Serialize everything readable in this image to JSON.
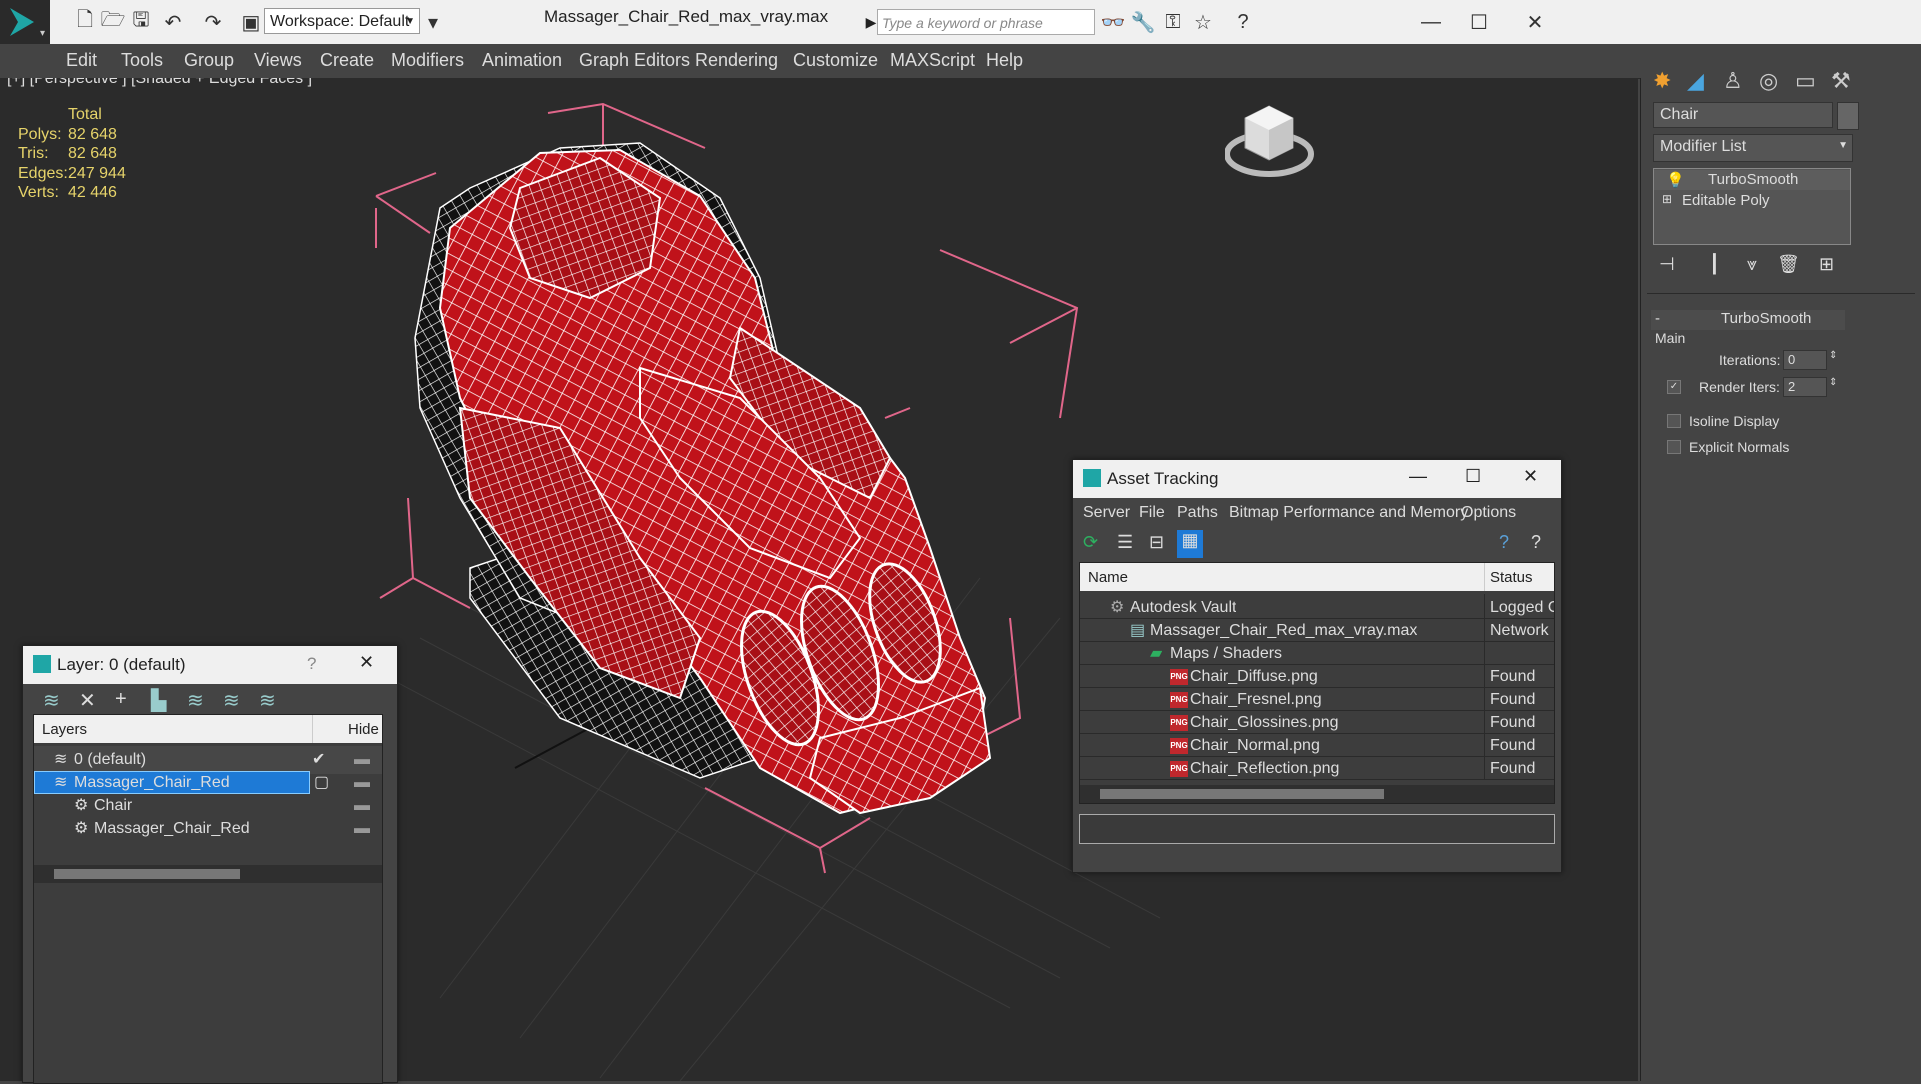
{
  "app": {
    "file_title": "Massager_Chair_Red_max_vray.max",
    "workspace": "Workspace: Default",
    "search_placeholder": "Type a keyword or phrase"
  },
  "menu": [
    "Edit",
    "Tools",
    "Group",
    "Views",
    "Create",
    "Modifiers",
    "Animation",
    "Graph Editors",
    "Rendering",
    "Customize",
    "MAXScript",
    "Help"
  ],
  "viewport": {
    "label": "[+] [Perspective ] [Shaded + Edged Faces ]",
    "stats_header": "Total",
    "stats": [
      {
        "label": "Polys:",
        "value": "82 648"
      },
      {
        "label": "Tris:",
        "value": "82 648"
      },
      {
        "label": "Edges:",
        "value": "247 944"
      },
      {
        "label": "Verts:",
        "value": "42 446"
      }
    ],
    "wire_color": "#ffffff",
    "mesh_color": "#c0121a"
  },
  "command_panel": {
    "object_name": "Chair",
    "modifier_list": "Modifier List",
    "stack": [
      "TurboSmooth",
      "Editable Poly"
    ],
    "rollout_title": "TurboSmooth",
    "group_main": "Main",
    "iterations_label": "Iterations:",
    "iterations_value": "0",
    "render_iters_label": "Render Iters:",
    "render_iters_value": "2",
    "render_iters_checked": true,
    "isoline_label": "Isoline Display",
    "explicit_normals_label": "Explicit Normals"
  },
  "layer_window": {
    "title": "Layer: 0 (default)",
    "help": "?",
    "col_layers": "Layers",
    "col_hide": "Hide",
    "rows": [
      {
        "name": "0 (default)",
        "indent": 1
      },
      {
        "name": "Massager_Chair_Red",
        "indent": 1,
        "selected": true
      },
      {
        "name": "Chair",
        "indent": 2
      },
      {
        "name": "Massager_Chair_Red",
        "indent": 2
      }
    ]
  },
  "asset_window": {
    "title": "Asset Tracking",
    "menu": [
      "Server",
      "File",
      "Paths",
      "Bitmap Performance and Memory",
      "Options"
    ],
    "col_name": "Name",
    "col_status": "Status",
    "rows": [
      {
        "name": "Autodesk Vault",
        "status": "Logged O",
        "indent": 1,
        "icon": "vault"
      },
      {
        "name": "Massager_Chair_Red_max_vray.max",
        "status": "Network F",
        "indent": 2,
        "icon": "max"
      },
      {
        "name": "Maps / Shaders",
        "status": "",
        "indent": 3,
        "icon": "maps"
      },
      {
        "name": "Chair_Diffuse.png",
        "status": "Found",
        "indent": 4,
        "icon": "png"
      },
      {
        "name": "Chair_Fresnel.png",
        "status": "Found",
        "indent": 4,
        "icon": "png"
      },
      {
        "name": "Chair_Glossines.png",
        "status": "Found",
        "indent": 4,
        "icon": "png"
      },
      {
        "name": "Chair_Normal.png",
        "status": "Found",
        "indent": 4,
        "icon": "png"
      },
      {
        "name": "Chair_Reflection.png",
        "status": "Found",
        "indent": 4,
        "icon": "png"
      }
    ]
  }
}
